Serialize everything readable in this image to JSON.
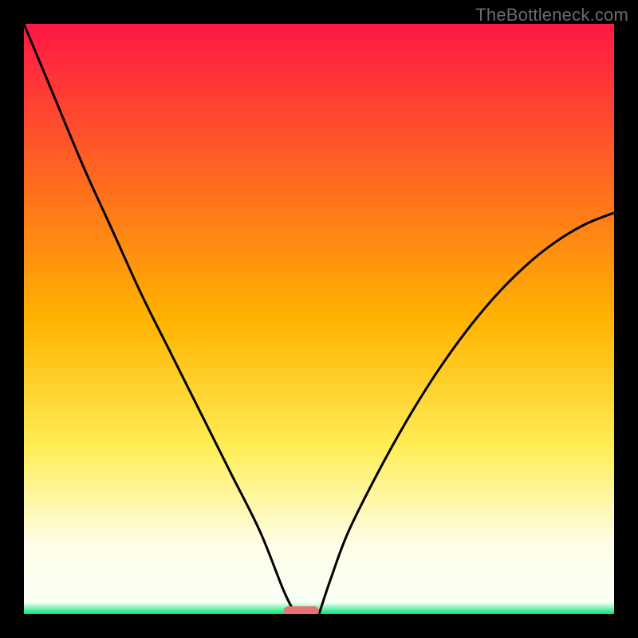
{
  "watermark": "TheBottleneck.com",
  "chart_data": {
    "type": "line",
    "title": "",
    "xlabel": "",
    "ylabel": "",
    "xlim": [
      0,
      100
    ],
    "ylim": [
      0,
      100
    ],
    "grid": false,
    "background_gradient": {
      "stops": [
        {
          "offset": 0.0,
          "color": "#ff1744"
        },
        {
          "offset": 0.5,
          "color": "#ffb300"
        },
        {
          "offset": 0.72,
          "color": "#ffee58"
        },
        {
          "offset": 0.88,
          "color": "#fffde7"
        },
        {
          "offset": 0.98,
          "color": "#fafff5"
        },
        {
          "offset": 1.0,
          "color": "#00e676"
        }
      ]
    },
    "series": [
      {
        "name": "left-branch",
        "x": [
          0,
          5,
          10,
          15,
          20,
          25,
          30,
          35,
          40,
          44,
          46
        ],
        "y": [
          100,
          88,
          76,
          65,
          54,
          44,
          34,
          24,
          14,
          4,
          0
        ]
      },
      {
        "name": "right-branch",
        "x": [
          50,
          52,
          55,
          60,
          65,
          70,
          75,
          80,
          85,
          90,
          95,
          100
        ],
        "y": [
          0,
          6,
          14,
          24,
          33,
          41,
          48,
          54,
          59,
          63,
          66,
          68
        ]
      }
    ],
    "marker": {
      "name": "min-region-bar",
      "x_range": [
        44,
        50
      ],
      "y": 0.5,
      "color": "#e57373",
      "thickness": 12
    },
    "legend": null
  }
}
